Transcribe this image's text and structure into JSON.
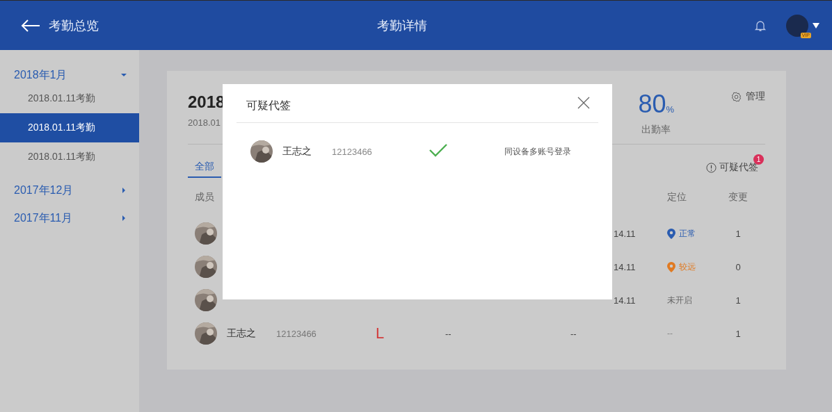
{
  "header": {
    "back_label": "考勤总览",
    "title": "考勤详情",
    "vip_badge": "VIP"
  },
  "sidebar": {
    "groups": [
      {
        "label": "2018年1月",
        "expanded": true,
        "items": [
          {
            "label": "2018.01.11考勤",
            "selected": false
          },
          {
            "label": "2018.01.11考勤",
            "selected": true
          },
          {
            "label": "2018.01.11考勤",
            "selected": false
          }
        ]
      },
      {
        "label": "2017年12月",
        "expanded": false
      },
      {
        "label": "2017年11月",
        "expanded": false
      }
    ]
  },
  "card": {
    "title": "2018",
    "subtitle": "2018.01",
    "rate_value": "80",
    "rate_unit": "%",
    "rate_label": "出勤率",
    "manage_label": "管理",
    "tabs": [
      {
        "label": "全部",
        "selected": true
      }
    ],
    "suspicious": {
      "label": "可疑代签",
      "count": "1"
    },
    "columns": {
      "member": "成员",
      "location": "定位",
      "changes": "变更"
    },
    "rows": [
      {
        "time": "14.11",
        "location": {
          "kind": "normal",
          "text": "正常"
        },
        "changes": "1"
      },
      {
        "time": "14.11",
        "location": {
          "kind": "far",
          "text": "较远"
        },
        "changes": "0"
      },
      {
        "time": "14.11",
        "location": {
          "kind": "off",
          "text": "未开启"
        },
        "changes": "1"
      },
      {
        "name": "王志之",
        "id": "12123466",
        "mark": "L",
        "column_4": "--",
        "column_5": "--",
        "location": {
          "kind": "none",
          "text": "--"
        },
        "changes": "1"
      }
    ]
  },
  "dialog": {
    "title": "可疑代签",
    "rows": [
      {
        "name": "王志之",
        "id": "12123466",
        "confirmed": true,
        "reason": "同设备多账号登录"
      }
    ]
  }
}
